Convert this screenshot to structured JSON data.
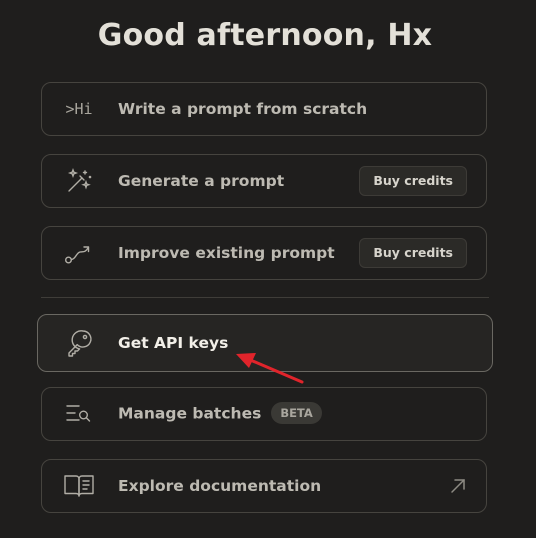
{
  "greeting": "Good afternoon, Hx",
  "cards": {
    "write": {
      "label": "Write a prompt from scratch",
      "icon_text": ">Hi"
    },
    "generate": {
      "label": "Generate a prompt",
      "action_label": "Buy credits"
    },
    "improve": {
      "label": "Improve existing prompt",
      "action_label": "Buy credits"
    },
    "api_keys": {
      "label": "Get API keys"
    },
    "batches": {
      "label": "Manage batches",
      "badge": "BETA"
    },
    "docs": {
      "label": "Explore documentation"
    }
  },
  "icons": {
    "write": "terminal-hi-icon",
    "generate": "magic-wand-icon",
    "improve": "path-arrow-icon",
    "api_keys": "key-icon",
    "batches": "list-search-icon",
    "docs": "book-icon",
    "external": "arrow-up-right-icon"
  },
  "colors": {
    "background": "#1f1e1d",
    "card_border": "#46443f",
    "annotation_arrow": "#e0242b"
  }
}
